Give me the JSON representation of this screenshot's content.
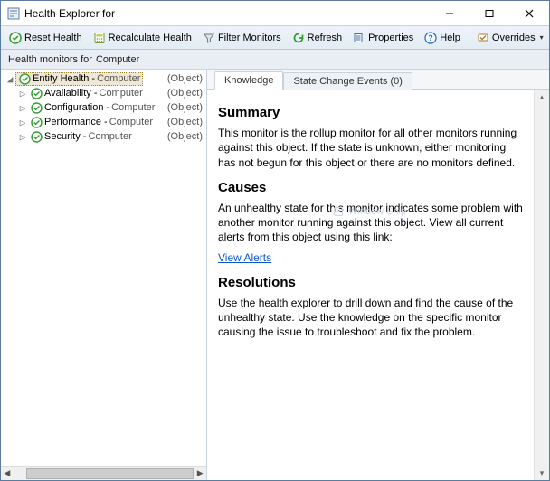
{
  "window": {
    "title": "Health Explorer for"
  },
  "toolbar": {
    "reset": "Reset Health",
    "recalc": "Recalculate Health",
    "filter": "Filter Monitors",
    "refresh": "Refresh",
    "properties": "Properties",
    "help": "Help",
    "overrides": "Overrides"
  },
  "subbar": {
    "prefix": "Health monitors for",
    "target": "Computer"
  },
  "tree": {
    "items": [
      {
        "exp": "◢",
        "label": "Entity Health",
        "sub": "Computer",
        "type": "(Object)",
        "selected": true,
        "indent": 0
      },
      {
        "exp": "▷",
        "label": "Availability",
        "sub": "Computer",
        "type": "(Object)",
        "selected": false,
        "indent": 1
      },
      {
        "exp": "▷",
        "label": "Configuration",
        "sub": "Computer",
        "type": "(Object)",
        "selected": false,
        "indent": 1
      },
      {
        "exp": "▷",
        "label": "Performance",
        "sub": "Computer",
        "type": "(Object)",
        "selected": false,
        "indent": 1
      },
      {
        "exp": "▷",
        "label": "Security",
        "sub": "Computer",
        "type": "(Object)",
        "selected": false,
        "indent": 1
      }
    ]
  },
  "tabs": {
    "knowledge": "Knowledge",
    "state_change": "State Change Events (0)"
  },
  "knowledge": {
    "h1": "Summary",
    "p1": "This monitor is the rollup monitor for all other monitors running against this object. If the state is unknown, either monitoring has not begun for this object or there are no monitors defined.",
    "h2": "Causes",
    "p2": "An unhealthy state for this monitor indicates some problem with another monitor running against this object. View all current alerts from this object using this link:",
    "link": "View Alerts",
    "h3": "Resolutions",
    "p3": "Use the health explorer to drill down and find the cause of the unhealthy state. Use the knowledge on the specific monitor causing the issue to troubleshoot and fix the problem."
  },
  "watermark": "Window Snip"
}
